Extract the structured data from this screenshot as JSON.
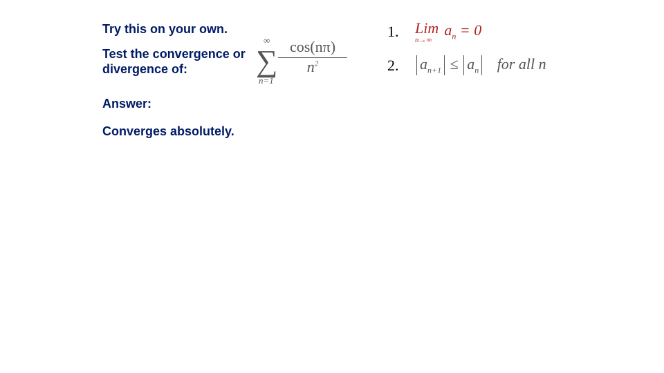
{
  "header": {
    "line1": "Try this on your own.",
    "line2": "Test the convergence or divergence of:"
  },
  "answer": {
    "label": "Answer:",
    "value": "Converges absolutely."
  },
  "series": {
    "sigma": "∑",
    "upper": "∞",
    "lower": "n=1",
    "numerator": "cos(nπ)",
    "denominator_base": "n",
    "denominator_exp": "2"
  },
  "conditions": {
    "row1": {
      "num": "1.",
      "lim": "Lim",
      "limsub": "n→∞",
      "an_a": "a",
      "an_sub": "n",
      "rhs": " = 0"
    },
    "row2": {
      "num": "2.",
      "a1": "a",
      "a1sub": "n+1",
      "rel": " ≤ ",
      "a2": "a",
      "a2sub": "n",
      "tail": "for all n"
    }
  }
}
